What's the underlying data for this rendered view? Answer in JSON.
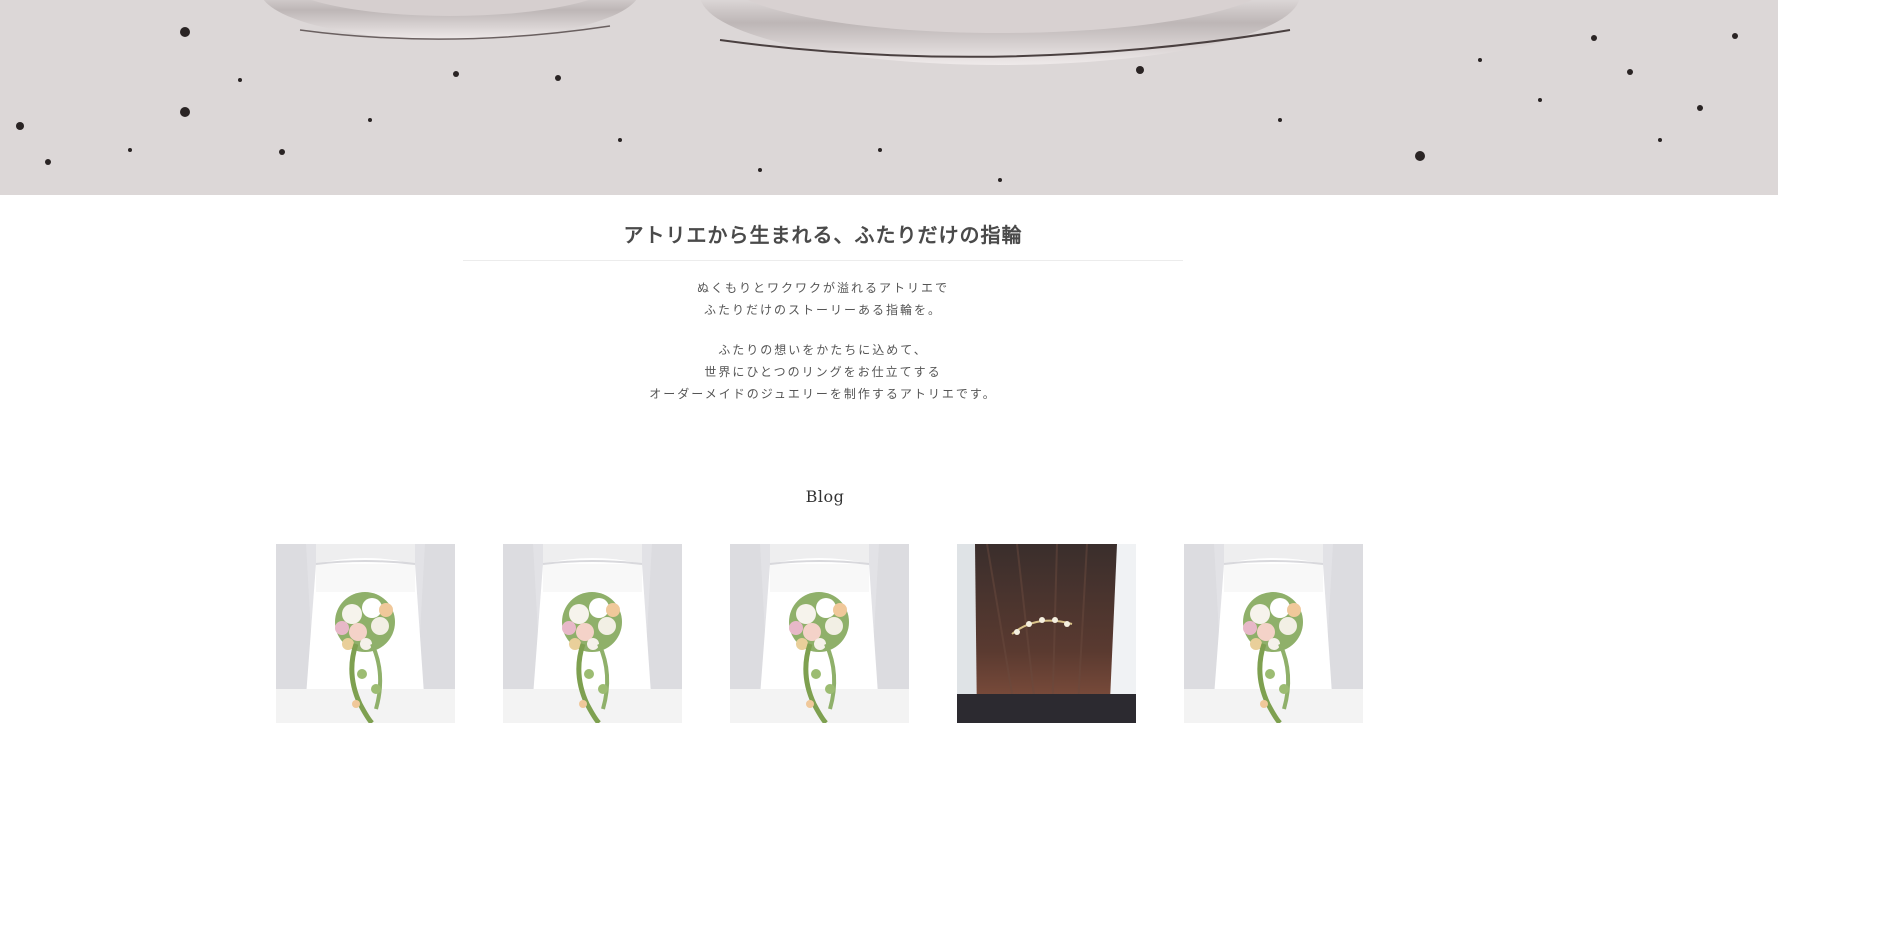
{
  "hero": {
    "image": "wedding-rings-on-concrete"
  },
  "intro": {
    "title": "アトリエから生まれる、ふたりだけの指輪",
    "paragraph1": [
      "ぬくもりとワクワクが溢れるアトリエで",
      "ふたりだけのストーリーある指輪を。"
    ],
    "paragraph2": [
      "ふたりの想いをかたちに込めて、",
      "世界にひとつのリングをお仕立てする",
      "オーダーメイドのジュエリーを制作するアトリエです。"
    ]
  },
  "blog": {
    "heading": "Blog",
    "posts": [
      {
        "image": "bride-bouquet"
      },
      {
        "image": "bride-bouquet"
      },
      {
        "image": "bride-bouquet"
      },
      {
        "image": "hair-accessory"
      },
      {
        "image": "bride-bouquet"
      }
    ]
  },
  "colors": {
    "text": "#555555",
    "heading": "#4a4a4a",
    "divider": "#ececec"
  }
}
